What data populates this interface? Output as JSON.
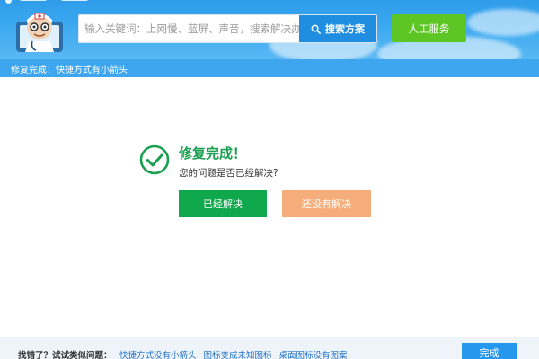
{
  "header": {
    "search": {
      "placeholder": "输入关键词：上网慢、蓝屏、声音，搜索解决办法",
      "button_label": "搜索方案"
    },
    "human_service_label": "人工服务"
  },
  "breadcrumb": {
    "text": "修复完成：快捷方式有小箭头"
  },
  "result": {
    "title": "修复完成！",
    "question": "您的问题是否已经解决?",
    "solved_label": "已经解决",
    "unsolved_label": "还没有解决"
  },
  "footer": {
    "label": "找错了？试试类似问题：",
    "links": [
      "快捷方式没有小箭头",
      "图标变成未知图标",
      "桌面图标没有图案"
    ],
    "done_label": "完成"
  },
  "colors": {
    "header_blue": "#2f9ce9",
    "search_button": "#1f8de0",
    "human_service_green": "#5dc624",
    "success_green": "#1aa050",
    "solved_button": "#0fa84d",
    "unsolved_button": "#f6ad7c",
    "done_button": "#2597ec"
  },
  "icons": {
    "mascot": "doctor-mascot-icon",
    "search": "search-icon",
    "check": "check-circle-icon"
  }
}
